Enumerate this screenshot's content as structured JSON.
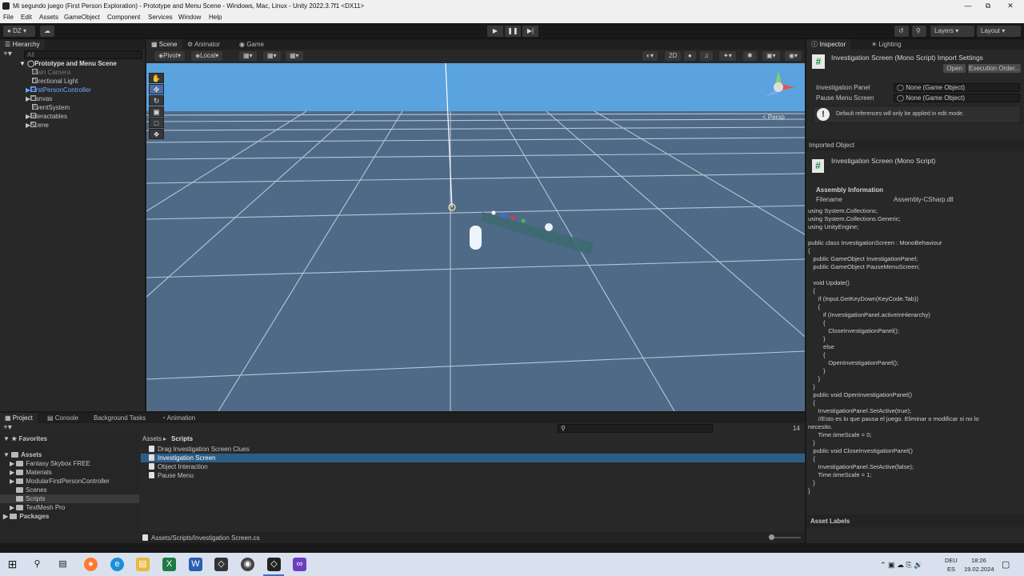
{
  "window": {
    "title": "Mi segundo juego (First Person Exploration) - Prototype and Menu Scene - Windows, Mac, Linux - Unity 2022.3.7f1 <DX11>"
  },
  "menu": [
    "File",
    "Edit",
    "Assets",
    "GameObject",
    "Component",
    "Services",
    "Window",
    "Help"
  ],
  "toolbar": {
    "account": "DZ",
    "layers": "Layers",
    "layout": "Layout"
  },
  "hierarchy": {
    "tab": "Hierarchy",
    "search_placeholder": "All",
    "scene": "Prototype and Menu Scene",
    "items": [
      "Main Camera",
      "Directional Light",
      "FirstPersonController",
      "Canvas",
      "EventSystem",
      "Interactables",
      "Scene"
    ]
  },
  "scene_tabs": [
    "Scene",
    "Animator",
    "Game"
  ],
  "scene_toolbar": {
    "pivot": "Pivot",
    "local": "Local",
    "mode2d": "2D"
  },
  "scene_view": {
    "persp": "< Persp"
  },
  "inspector": {
    "tabs": [
      "Inspector",
      "Lighting"
    ],
    "header": "Investigation Screen (Mono Script) Import Settings",
    "open": "Open",
    "exec": "Execution Order...",
    "fields": [
      {
        "label": "Investigation Panel",
        "value": "None (Game Object)"
      },
      {
        "label": "Pause Menu Screen",
        "value": "None (Game Object)"
      }
    ],
    "info": "Default references will only be applied in edit mode.",
    "imported_label": "Imported Object",
    "imported_name": "Investigation Screen (Mono Script)",
    "assembly_title": "Assembly Information",
    "filename_label": "Filename",
    "filename_value": "Assembly-CSharp.dll",
    "code": "using System.Collections;\nusing System.Collections.Generic;\nusing UnityEngine;\n\npublic class InvestigationScreen : MonoBehaviour\n{\n   public GameObject InvestigationPanel;\n   public GameObject PauseMenuScreen;\n\n   void Update()\n   {\n      if (Input.GetKeyDown(KeyCode.Tab))\n      {\n         if (InvestigationPanel.activeInHierarchy)\n         {\n            CloseInvestigationPanel();\n         }\n         else\n         {\n            OpenInvestigationPanel();\n         }\n      }\n   }\n   public void OpenInvestigationPanel()\n   {\n      InvestigationPanel.SetActive(true);\n      //Esto es lo que pausa el juego. Eliminar o modificar si no lo\nnecesito.\n      Time.timeScale = 0;\n   }\n   public void CloseInvestigationPanel()\n   {\n      InvestigationPanel.SetActive(false);\n      Time.timeScale = 1;\n   }\n}",
    "asset_labels": "Asset Labels"
  },
  "project": {
    "tabs": [
      "Project",
      "Console",
      "Background Tasks",
      "Animation"
    ],
    "favorites": "Favorites",
    "assets": "Assets",
    "folders": [
      "Fantasy Skybox FREE",
      "Materials",
      "ModularFirstPersonController",
      "Scenes",
      "Scripts",
      "TextMesh Pro"
    ],
    "packages": "Packages",
    "breadcrumb": [
      "Assets",
      "Scripts"
    ],
    "files": [
      "Drag Investigation Screen Clues",
      "Investigation Screen",
      "Object Interaction",
      "Pause Menu"
    ],
    "selected_path": "Assets/Scripts/Investigation Screen.cs",
    "hidden_count": "14"
  },
  "taskbar": {
    "lang": "DEU",
    "lang2": "ES",
    "time": "18:26",
    "date": "19.02.2024"
  },
  "colors": {
    "sky": "#5aa3de",
    "ground": "#4f6a87",
    "selected": "#2c5d87",
    "accent": "#4f9bff"
  }
}
